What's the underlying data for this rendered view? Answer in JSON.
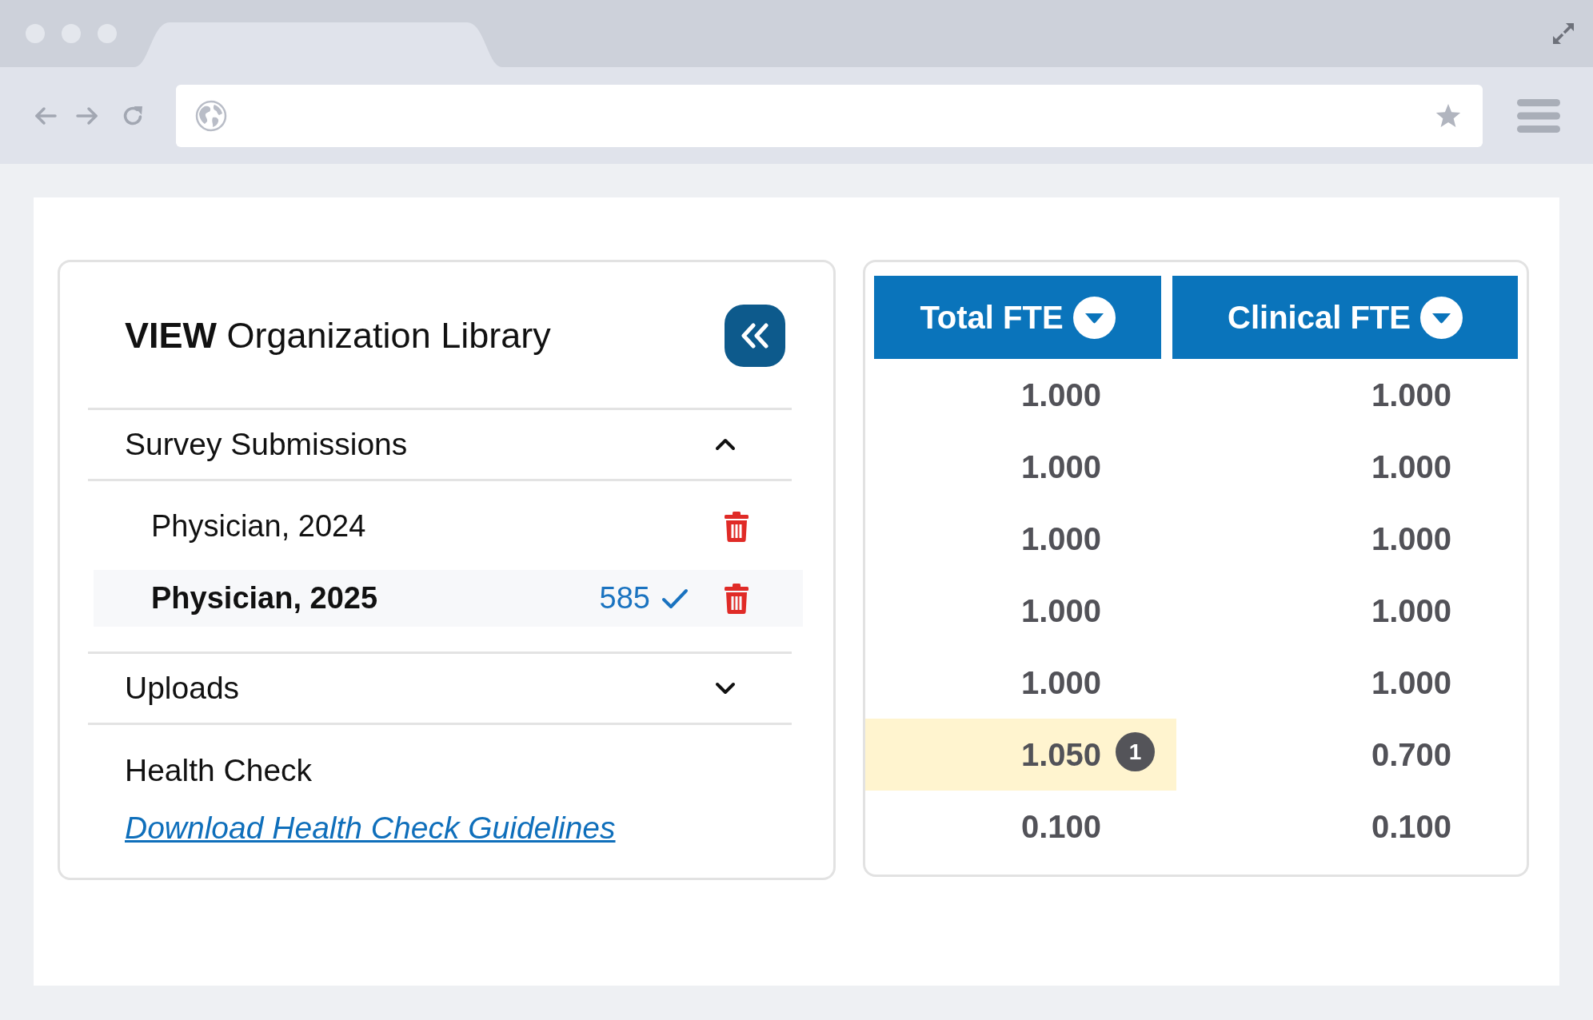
{
  "library_panel": {
    "title": "**VIEW** Organization Library",
    "sections": [
      {
        "kind": "accordion",
        "label": "Survey Submissions",
        "expanded": true,
        "items": [
          {
            "label": "Physician, 2024",
            "selected": false,
            "verified": false
          },
          {
            "label": "Physician, 2025",
            "selected": true,
            "count": "585",
            "verified": true
          }
        ]
      },
      {
        "kind": "accordion",
        "label": "Uploads",
        "expanded": false
      },
      {
        "kind": "resource",
        "label": "Health Check",
        "link": "Download Health Check Guidelines"
      }
    ]
  },
  "fte_table": {
    "columns": [
      {
        "label": "Total FTE"
      },
      {
        "label": "Clinical FTE"
      }
    ],
    "rows": [
      {
        "cells": [
          {
            "value": "1.000",
            "highlighted": false
          },
          {
            "value": "1.000",
            "highlighted": false
          }
        ]
      },
      {
        "cells": [
          {
            "value": "1.000",
            "highlighted": false
          },
          {
            "value": "1.000",
            "highlighted": false
          }
        ]
      },
      {
        "cells": [
          {
            "value": "1.000",
            "highlighted": false
          },
          {
            "value": "1.000",
            "highlighted": false
          }
        ]
      },
      {
        "cells": [
          {
            "value": "1.000",
            "highlighted": false
          },
          {
            "value": "1.000",
            "highlighted": false
          }
        ]
      },
      {
        "cells": [
          {
            "value": "1.000",
            "highlighted": false
          },
          {
            "value": "1.000",
            "highlighted": false
          }
        ]
      },
      {
        "cells": [
          {
            "value": "1.050",
            "highlighted": true,
            "badge": "1"
          },
          {
            "value": "0.700",
            "highlighted": false
          }
        ]
      },
      {
        "cells": [
          {
            "value": "0.100",
            "highlighted": false
          },
          {
            "value": "0.100",
            "highlighted": false
          }
        ]
      }
    ]
  }
}
